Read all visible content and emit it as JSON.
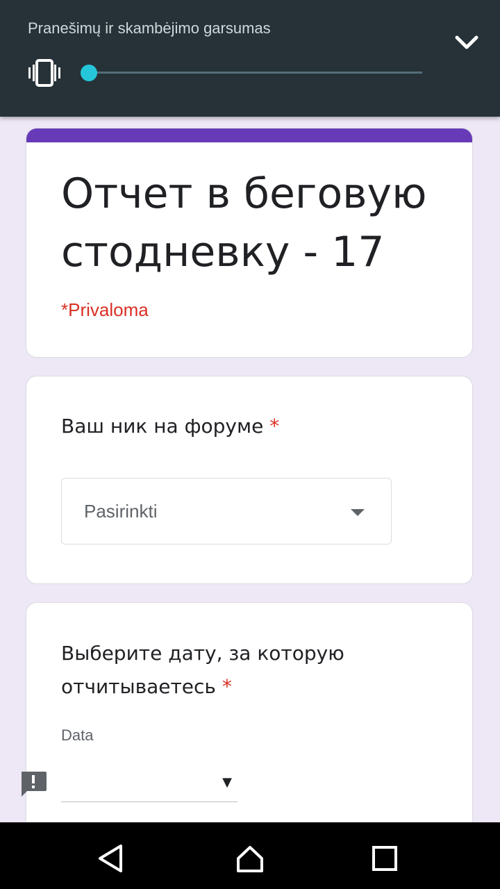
{
  "volume_panel": {
    "title": "Pranešimų ir skambėjimo garsumas",
    "mode_icon": "vibrate-icon",
    "level": 0.0,
    "accent_color": "#26c6da",
    "collapse_icon": "chevron-down-icon"
  },
  "form": {
    "accent_color": "#673ab7",
    "title": "Отчет в беговую стодневку - 17",
    "required_note": "*Privaloma",
    "questions": [
      {
        "title": "Ваш ник на форуме",
        "required_marker": "*",
        "type": "dropdown",
        "placeholder": "Pasirinkti"
      },
      {
        "title": "Выберите дату, за которую отчитываетесь",
        "required_marker": "*",
        "type": "date",
        "sub_label": "Data",
        "value": "",
        "arrow": "▼"
      }
    ]
  },
  "feedback": {
    "icon": "feedback-icon"
  },
  "nav_bar": {
    "back_icon": "back-triangle-icon",
    "home_icon": "home-icon",
    "recents_icon": "recents-square-icon"
  }
}
